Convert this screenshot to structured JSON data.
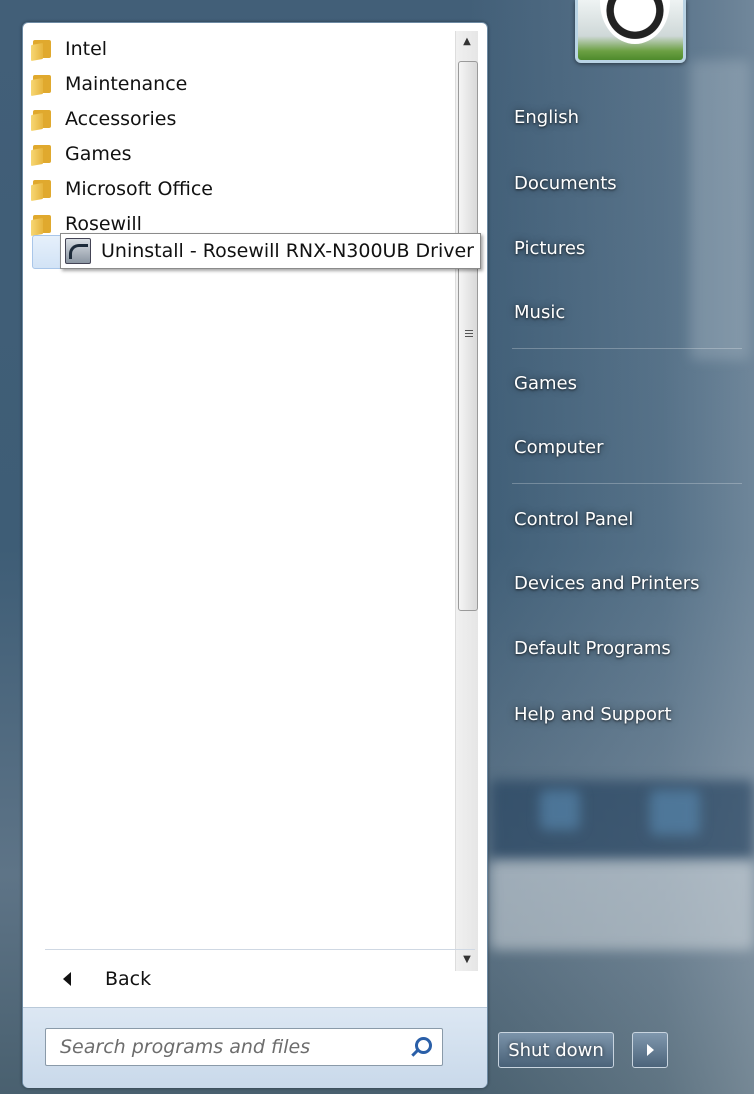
{
  "programs": {
    "folders": [
      {
        "label": "Intel"
      },
      {
        "label": "Maintenance"
      },
      {
        "label": "Accessories"
      },
      {
        "label": "Games"
      },
      {
        "label": "Microsoft Office"
      },
      {
        "label": "Rosewill"
      }
    ],
    "subitem_label": "Uninstall - Rosewill RNX-N300UB Driver",
    "back_label": "Back"
  },
  "search": {
    "placeholder": "Search programs and files"
  },
  "right_menu": {
    "items": [
      "English",
      "Documents",
      "Pictures",
      "Music",
      "Games",
      "Computer",
      "Control Panel",
      "Devices and Printers",
      "Default Programs",
      "Help and Support"
    ]
  },
  "shutdown": {
    "label": "Shut down"
  },
  "colors": {
    "accent": "#2a5fa8",
    "panel_bg": "#ffffff",
    "aero_bg": "#415f78"
  }
}
